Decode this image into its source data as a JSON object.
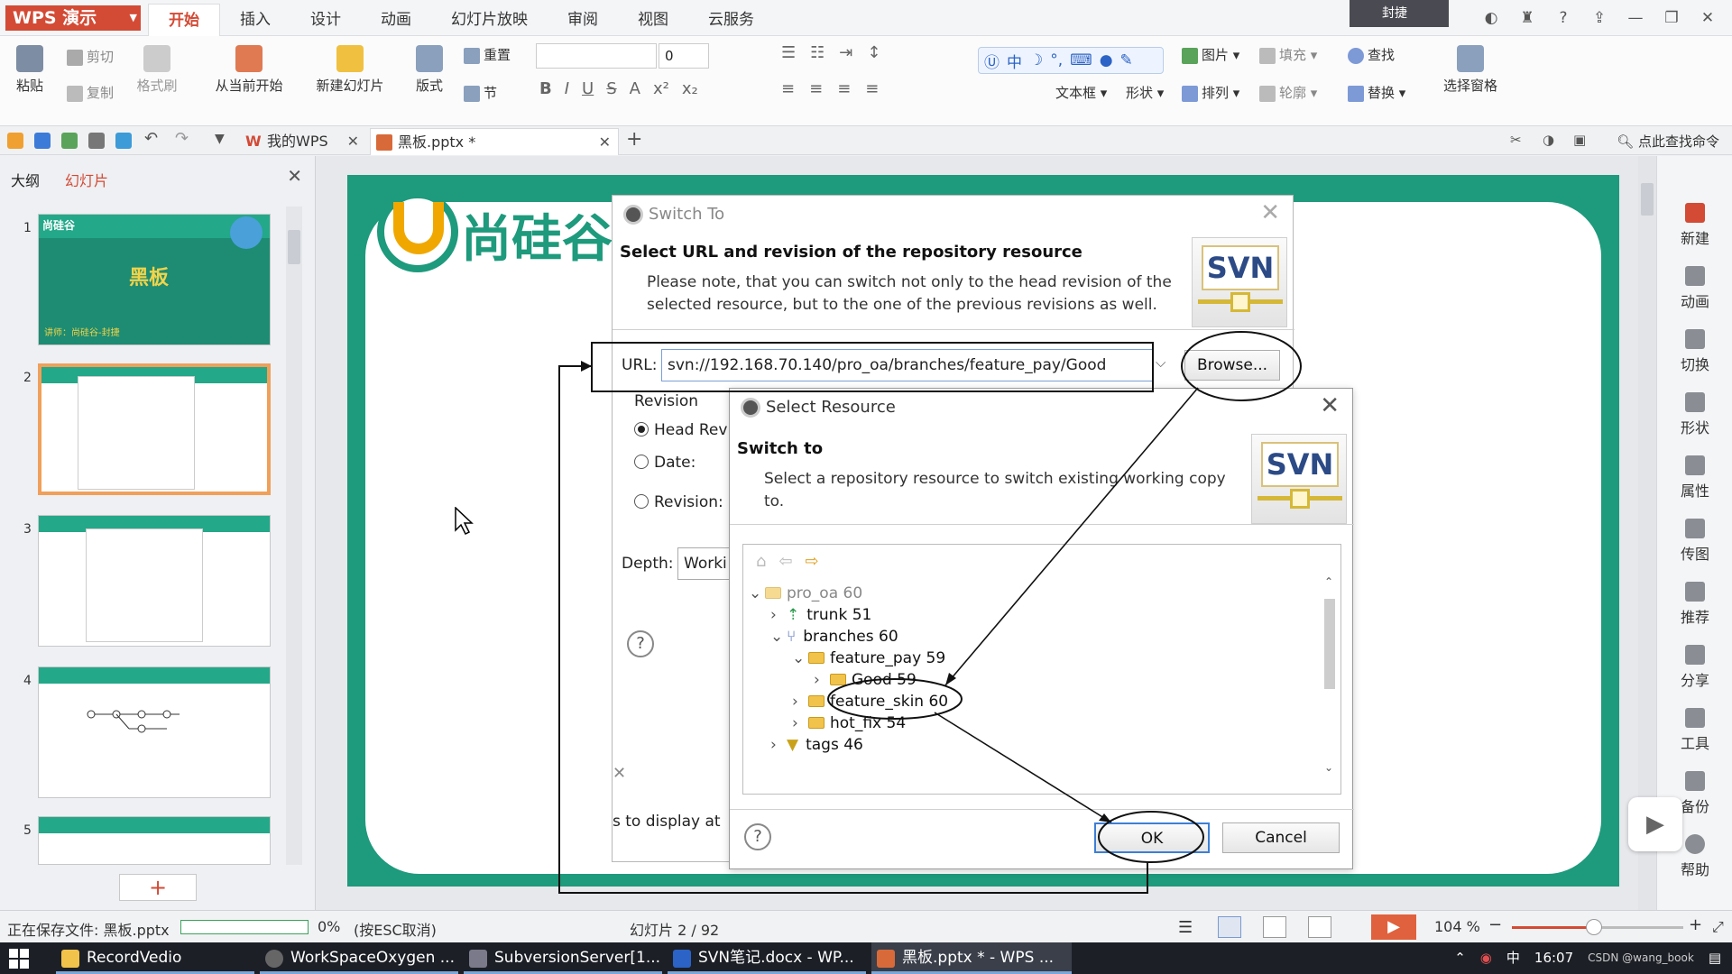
{
  "app": {
    "logo": "WPS 演示",
    "menu_tabs": [
      "开始",
      "插入",
      "设计",
      "动画",
      "幻灯片放映",
      "审阅",
      "视图",
      "云服务"
    ],
    "user_label": "封捷"
  },
  "ribbon": {
    "paste": "粘贴",
    "cut": "剪切",
    "copy": "复制",
    "format_painter": "格式刷",
    "from_current": "从当前开始",
    "new_slide": "新建幻灯片",
    "layout": "版式",
    "reset": "重置",
    "section": "节",
    "font_size": "0",
    "textbox": "文本框",
    "shape": "形状",
    "picture": "图片",
    "fill": "填充",
    "arrange": "排列",
    "outline": "轮廓",
    "find": "查找",
    "replace": "替换",
    "select_pane": "选择窗格"
  },
  "doc_tabs": [
    {
      "label": "我的WPS"
    },
    {
      "label": "黑板.pptx *"
    }
  ],
  "find_command": "点此查找命令",
  "left_panel": {
    "tab_outline": "大纲",
    "tab_slides": "幻灯片",
    "slide_numbers": [
      "1",
      "2",
      "3",
      "4",
      "5"
    ],
    "thumb1_title": "黑板",
    "thumb1_logo": "尚硅谷",
    "thumb1_footer": "讲师：尚硅谷-封捷"
  },
  "slide": {
    "brand": "尚硅谷"
  },
  "switch_to": {
    "title": "Switch To",
    "heading": "Select URL and revision of the repository resource",
    "desc1": "Please note, that you can switch not only to the head revision of the",
    "desc2": "selected resource, but to the one of the previous revisions as well.",
    "url_label": "URL:",
    "url_value": "svn://192.168.70.140/pro_oa/branches/feature_pay/Good",
    "browse": "Browse...",
    "revision_group": "Revision",
    "head_rev": "Head Rev",
    "date": "Date:",
    "revision": "Revision:",
    "depth": "Depth:",
    "depth_value": "Worki",
    "bottom_text": "s to display at",
    "svn_badge": "SVN"
  },
  "select_resource": {
    "title": "Select Resource",
    "heading": "Switch to",
    "desc1": "Select a repository resource to switch existing working copy",
    "desc2": "to.",
    "svn_badge": "SVN",
    "tree": [
      {
        "label": "pro_oa 60"
      },
      {
        "label": "trunk 51"
      },
      {
        "label": "branches 60"
      },
      {
        "label": "feature_pay 59"
      },
      {
        "label": "Good 59"
      },
      {
        "label": "feature_skin 60"
      },
      {
        "label": "hot_fix 54"
      },
      {
        "label": "tags 46"
      }
    ],
    "ok": "OK",
    "cancel": "Cancel"
  },
  "right_bar": [
    "新建",
    "动画",
    "切换",
    "形状",
    "属性",
    "传图",
    "推荐",
    "分享",
    "工具",
    "备份",
    "帮助"
  ],
  "status": {
    "saving": "正在保存文件: 黑板.pptx",
    "progress_pct": "0%",
    "progress_fraction": 0.0,
    "esc_hint": "(按ESC取消)",
    "slide_pos": "幻灯片 2 / 92",
    "zoom": "104 %",
    "zoom_fraction": 0.48
  },
  "taskbar": {
    "tasks": [
      "RecordVedio",
      "WorkSpaceOxygen ...",
      "SubversionServer[1...",
      "SVN笔记.docx - WP...",
      "黑板.pptx * - WPS ..."
    ],
    "ime": "中",
    "clock": "16:07",
    "watermark": "CSDN @wang_book"
  }
}
